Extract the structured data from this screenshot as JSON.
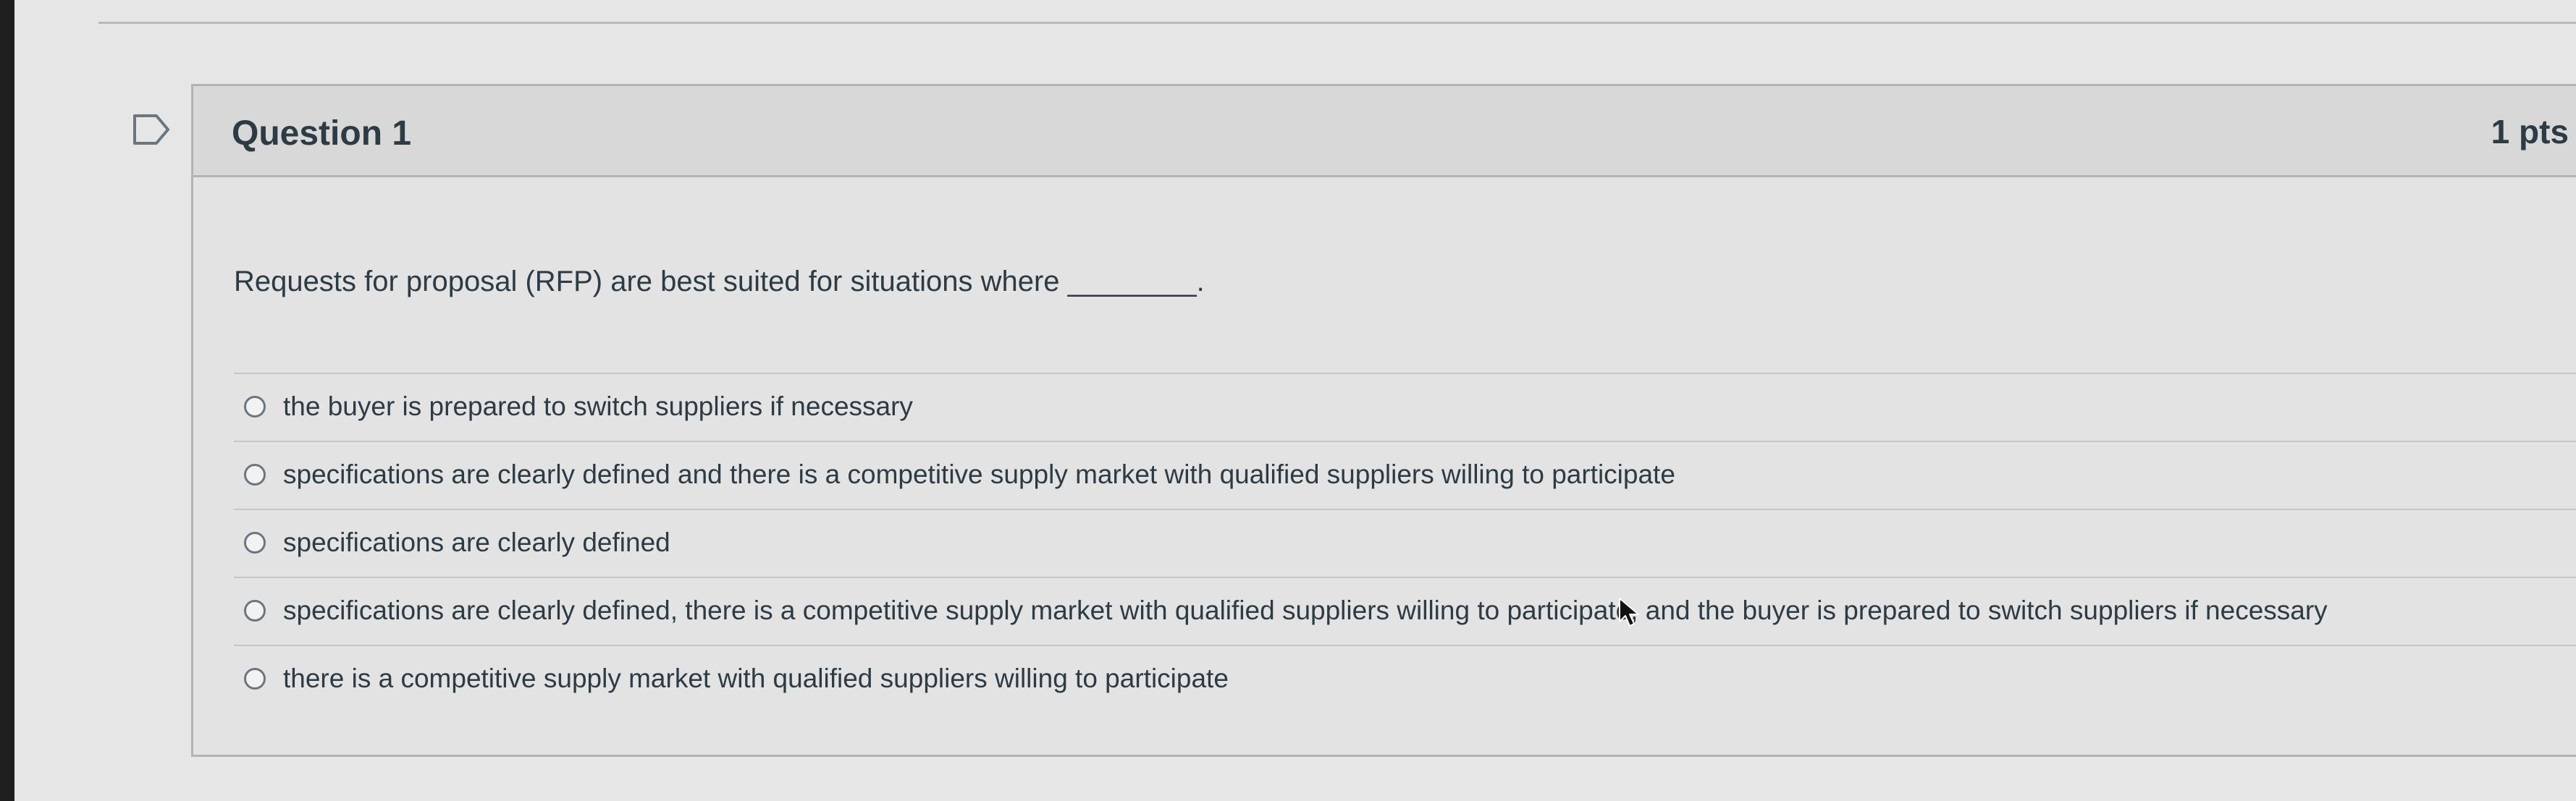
{
  "question": {
    "title": "Question 1",
    "points": "1 pts",
    "text": "Requests for proposal (RFP) are best suited for situations where ________.",
    "flag_icon": "flag-icon",
    "answers": [
      {
        "label": "the buyer is prepared to switch suppliers if necessary",
        "selected": false
      },
      {
        "label": "specifications are clearly defined and there is a competitive supply market with qualified suppliers willing to participate",
        "selected": false
      },
      {
        "label": "specifications are clearly defined",
        "selected": false
      },
      {
        "label": "specifications are clearly defined, there is a competitive supply market with qualified suppliers willing to participate, and the buyer is prepared to switch suppliers if necessary",
        "selected": false
      },
      {
        "label": "there is a competitive supply market with qualified suppliers willing to participate",
        "selected": false
      }
    ]
  },
  "colors": {
    "text": "#2d3b45",
    "border": "#b3b3b3",
    "header_bg": "#d8d8d8",
    "body_bg": "#e3e3e3"
  },
  "icons": {
    "radio": "radio-button-icon",
    "cursor": "mouse-pointer-icon"
  }
}
